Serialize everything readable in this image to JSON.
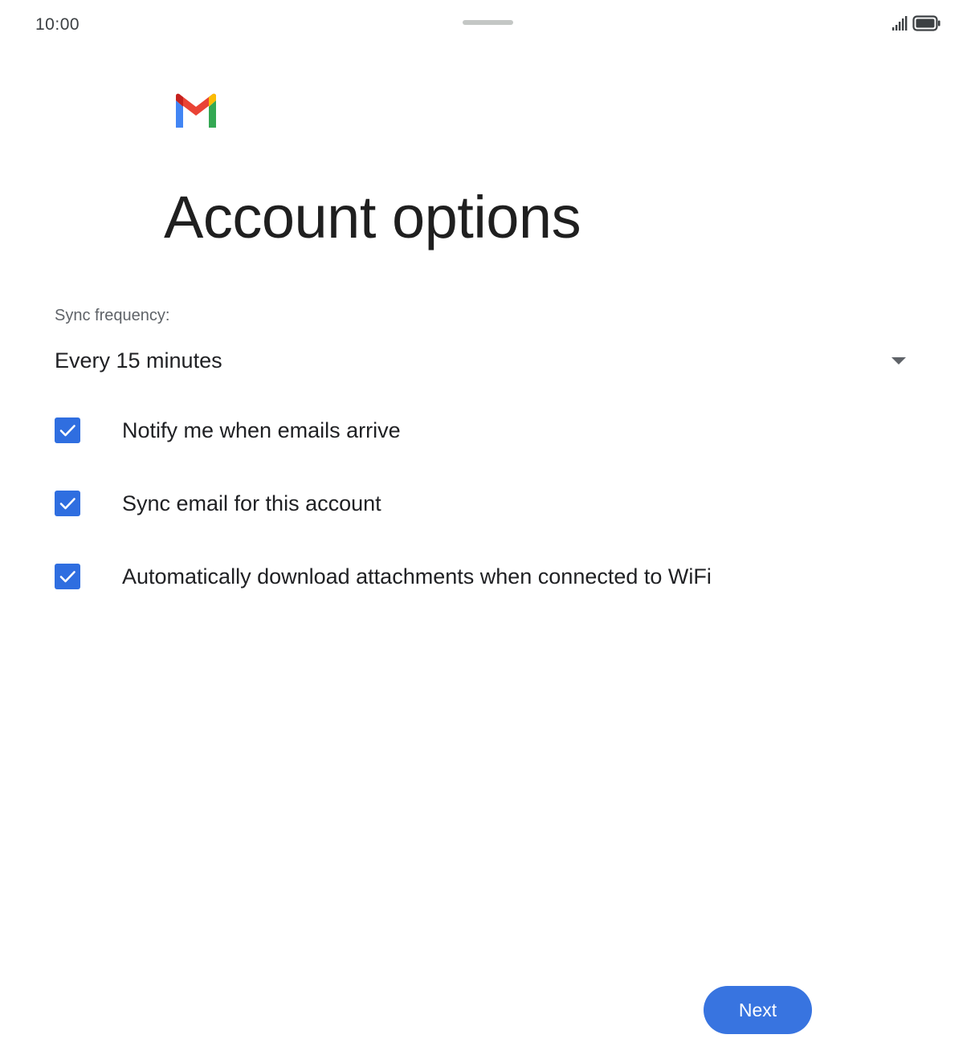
{
  "status_bar": {
    "time": "10:00",
    "signal_icon": "signal-icon",
    "battery_icon": "battery-icon"
  },
  "header": {
    "logo_icon": "gmail-logo-icon",
    "title": "Account options"
  },
  "sync": {
    "label": "Sync frequency:",
    "selected_value": "Every 15 minutes",
    "dropdown_icon": "chevron-down-icon"
  },
  "options": [
    {
      "label": "Notify me when emails arrive",
      "checked": true
    },
    {
      "label": "Sync email for this account",
      "checked": true
    },
    {
      "label": "Automatically download attachments when connected to WiFi",
      "checked": true
    }
  ],
  "footer": {
    "next_label": "Next"
  },
  "colors": {
    "accent": "#3874e0",
    "checkbox": "#2f6ee0",
    "gmail_red": "#ea4335",
    "gmail_blue": "#4285f4",
    "gmail_green": "#34a853",
    "gmail_yellow": "#fbbc04"
  }
}
